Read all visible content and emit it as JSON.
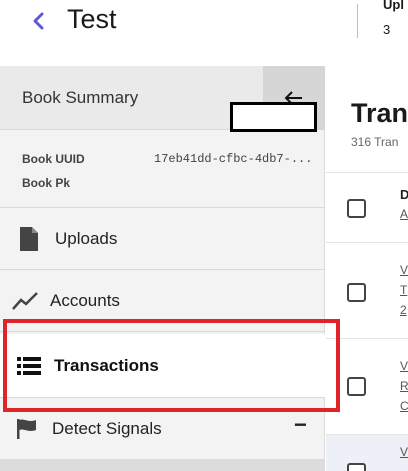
{
  "header": {
    "title": "Test",
    "back_icon": "chevron-left-icon",
    "uploads_label": "Upl",
    "uploads_value": "3"
  },
  "sidebar": {
    "book_summary_label": "Book Summary",
    "collapse_icon": "arrow-left-icon",
    "book_uuid_label": "Book UUID",
    "book_uuid_value": "17eb41dd-cfbc-4db7-...",
    "book_pk_label": "Book Pk",
    "book_pk_value": "",
    "items": [
      {
        "label": "Uploads",
        "icon": "file-icon"
      },
      {
        "label": "Accounts",
        "icon": "chart-line-icon"
      },
      {
        "label": "Transactions",
        "icon": "list-icon",
        "active": true
      },
      {
        "label": "Detect Signals",
        "icon": "flag-icon",
        "expanded": true
      }
    ]
  },
  "main": {
    "title": "Tran",
    "subtitle": "316 Tran",
    "header_row_text": "D",
    "header_row_link": "A",
    "rows": [
      {
        "line1": "V",
        "line2": "T",
        "line3": "2"
      },
      {
        "line1": "V",
        "line2": "R",
        "line3": "C"
      },
      {
        "line1": "V"
      }
    ]
  },
  "colors": {
    "accent": "#5b5bd6",
    "highlight": "#e0252a",
    "sidebar_bg": "#f3f3f3"
  }
}
